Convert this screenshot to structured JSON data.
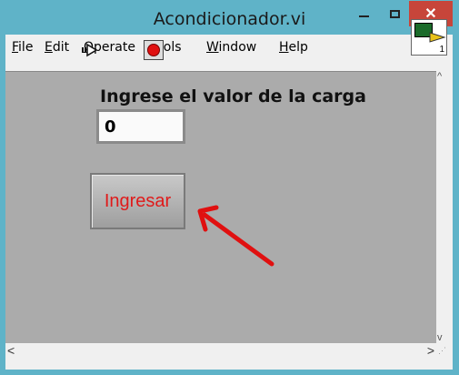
{
  "window": {
    "title": "Acondicionador.vi",
    "close_glyph": "✕"
  },
  "menu": {
    "items": [
      {
        "underline": "F",
        "rest": "ile"
      },
      {
        "underline": "E",
        "rest": "dit"
      },
      {
        "underline": "O",
        "rest": "perate"
      },
      {
        "underline": "T",
        "rest": "ools"
      },
      {
        "underline": "W",
        "rest": "indow"
      },
      {
        "underline": "H",
        "rest": "elp"
      }
    ]
  },
  "toolbar": {
    "run_icon": "run-arrow-icon",
    "abort_icon": "abort-stop-icon"
  },
  "vi_icon": {
    "number": "1"
  },
  "panel": {
    "label": "Ingrese el valor de la carga",
    "numeric_value": "0",
    "button_label": "Ingresar",
    "button_text_color": "#e01a1a",
    "panel_color": "#ababab",
    "annotation_color": "#e01010"
  },
  "scroll": {
    "up": "^",
    "down": "v",
    "left": "<",
    "right": ">"
  }
}
